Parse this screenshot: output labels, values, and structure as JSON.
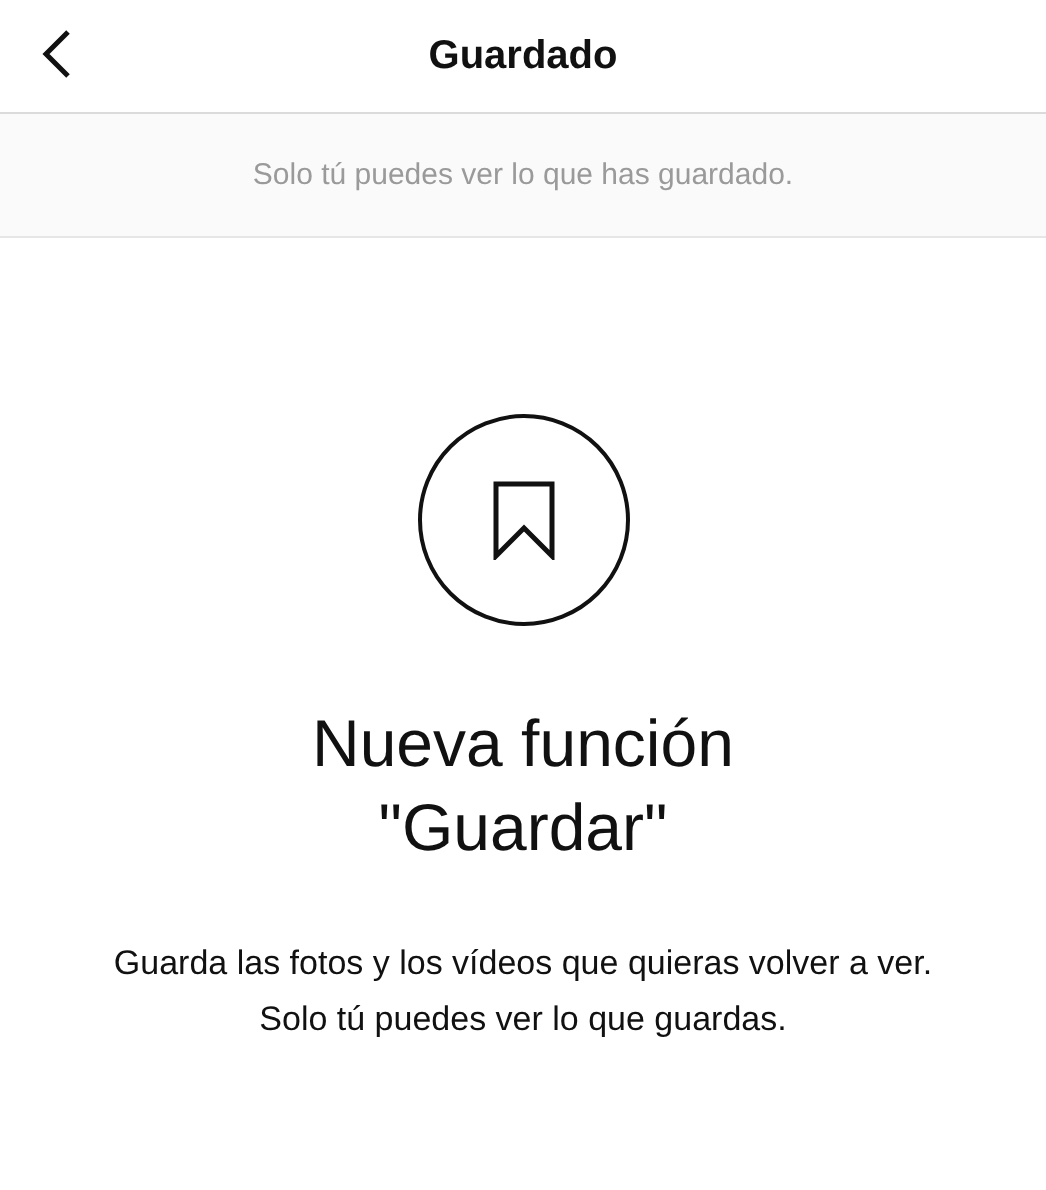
{
  "header": {
    "title": "Guardado"
  },
  "notice": "Solo tú puedes ver lo que has guardado.",
  "empty_state": {
    "heading_lines": [
      "Nueva función",
      "\"Guardar\""
    ],
    "body": "Guarda las fotos y los vídeos que quieras volver a ver. Solo tú puedes ver lo que guardas."
  }
}
